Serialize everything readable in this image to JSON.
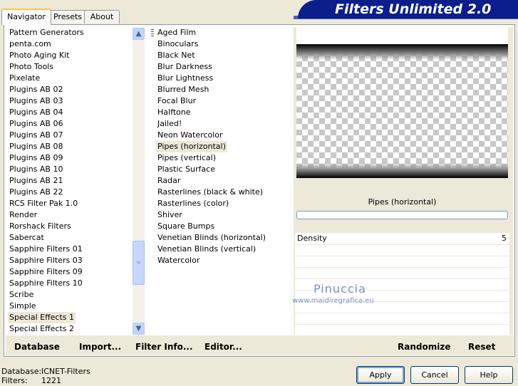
{
  "tabs": [
    "Navigator",
    "Presets",
    "About"
  ],
  "banner_title": "Filters Unlimited 2.0",
  "categories": [
    "Pattern Generators",
    "penta.com",
    "Photo Aging Kit",
    "Photo Tools",
    "Pixelate",
    "Plugins AB 02",
    "Plugins AB 03",
    "Plugins AB 04",
    "Plugins AB 06",
    "Plugins AB 07",
    "Plugins AB 08",
    "Plugins AB 09",
    "Plugins AB 10",
    "Plugins AB 21",
    "Plugins AB 22",
    "RCS Filter Pak 1.0",
    "Render",
    "Rorshack Filters",
    "Sabercat",
    "Sapphire Filters 01",
    "Sapphire Filters 03",
    "Sapphire Filters 09",
    "Sapphire Filters 10",
    "Scribe",
    "Simple",
    "Special Effects 1",
    "Special Effects 2"
  ],
  "selected_category": "Special Effects 1",
  "filters": [
    "Aged Film",
    "Binoculars",
    "Black Net",
    "Blur Darkness",
    "Blur Lightness",
    "Blurred Mesh",
    "Focal Blur",
    "Halftone",
    "Jailed!",
    "Neon Watercolor",
    "Pipes (horizontal)",
    "Pipes (vertical)",
    "Plastic Surface",
    "Radar",
    "Rasterlines (black & white)",
    "Rasterlines (color)",
    "Shiver",
    "Square Bumps",
    "Venetian Blinds (horizontal)",
    "Venetian Blinds (vertical)",
    "Watercolor"
  ],
  "selected_filter": "Pipes (horizontal)",
  "preview_filter_name": "Pipes (horizontal)",
  "params": [
    {
      "label": "Density",
      "value": "5"
    }
  ],
  "watermark": {
    "line1": "Pinuccia",
    "line2": "www.maidiregrafica.eu"
  },
  "toolbar": {
    "database": "Database",
    "import": "Import...",
    "filter_info": "Filter Info...",
    "editor": "Editor...",
    "randomize": "Randomize",
    "reset": "Reset"
  },
  "status": {
    "database_label": "Database:",
    "database_value": "ICNET-Filters",
    "filters_label": "Filters:",
    "filters_value": "1221"
  },
  "buttons": {
    "apply": "Apply",
    "cancel": "Cancel",
    "help": "Help"
  }
}
